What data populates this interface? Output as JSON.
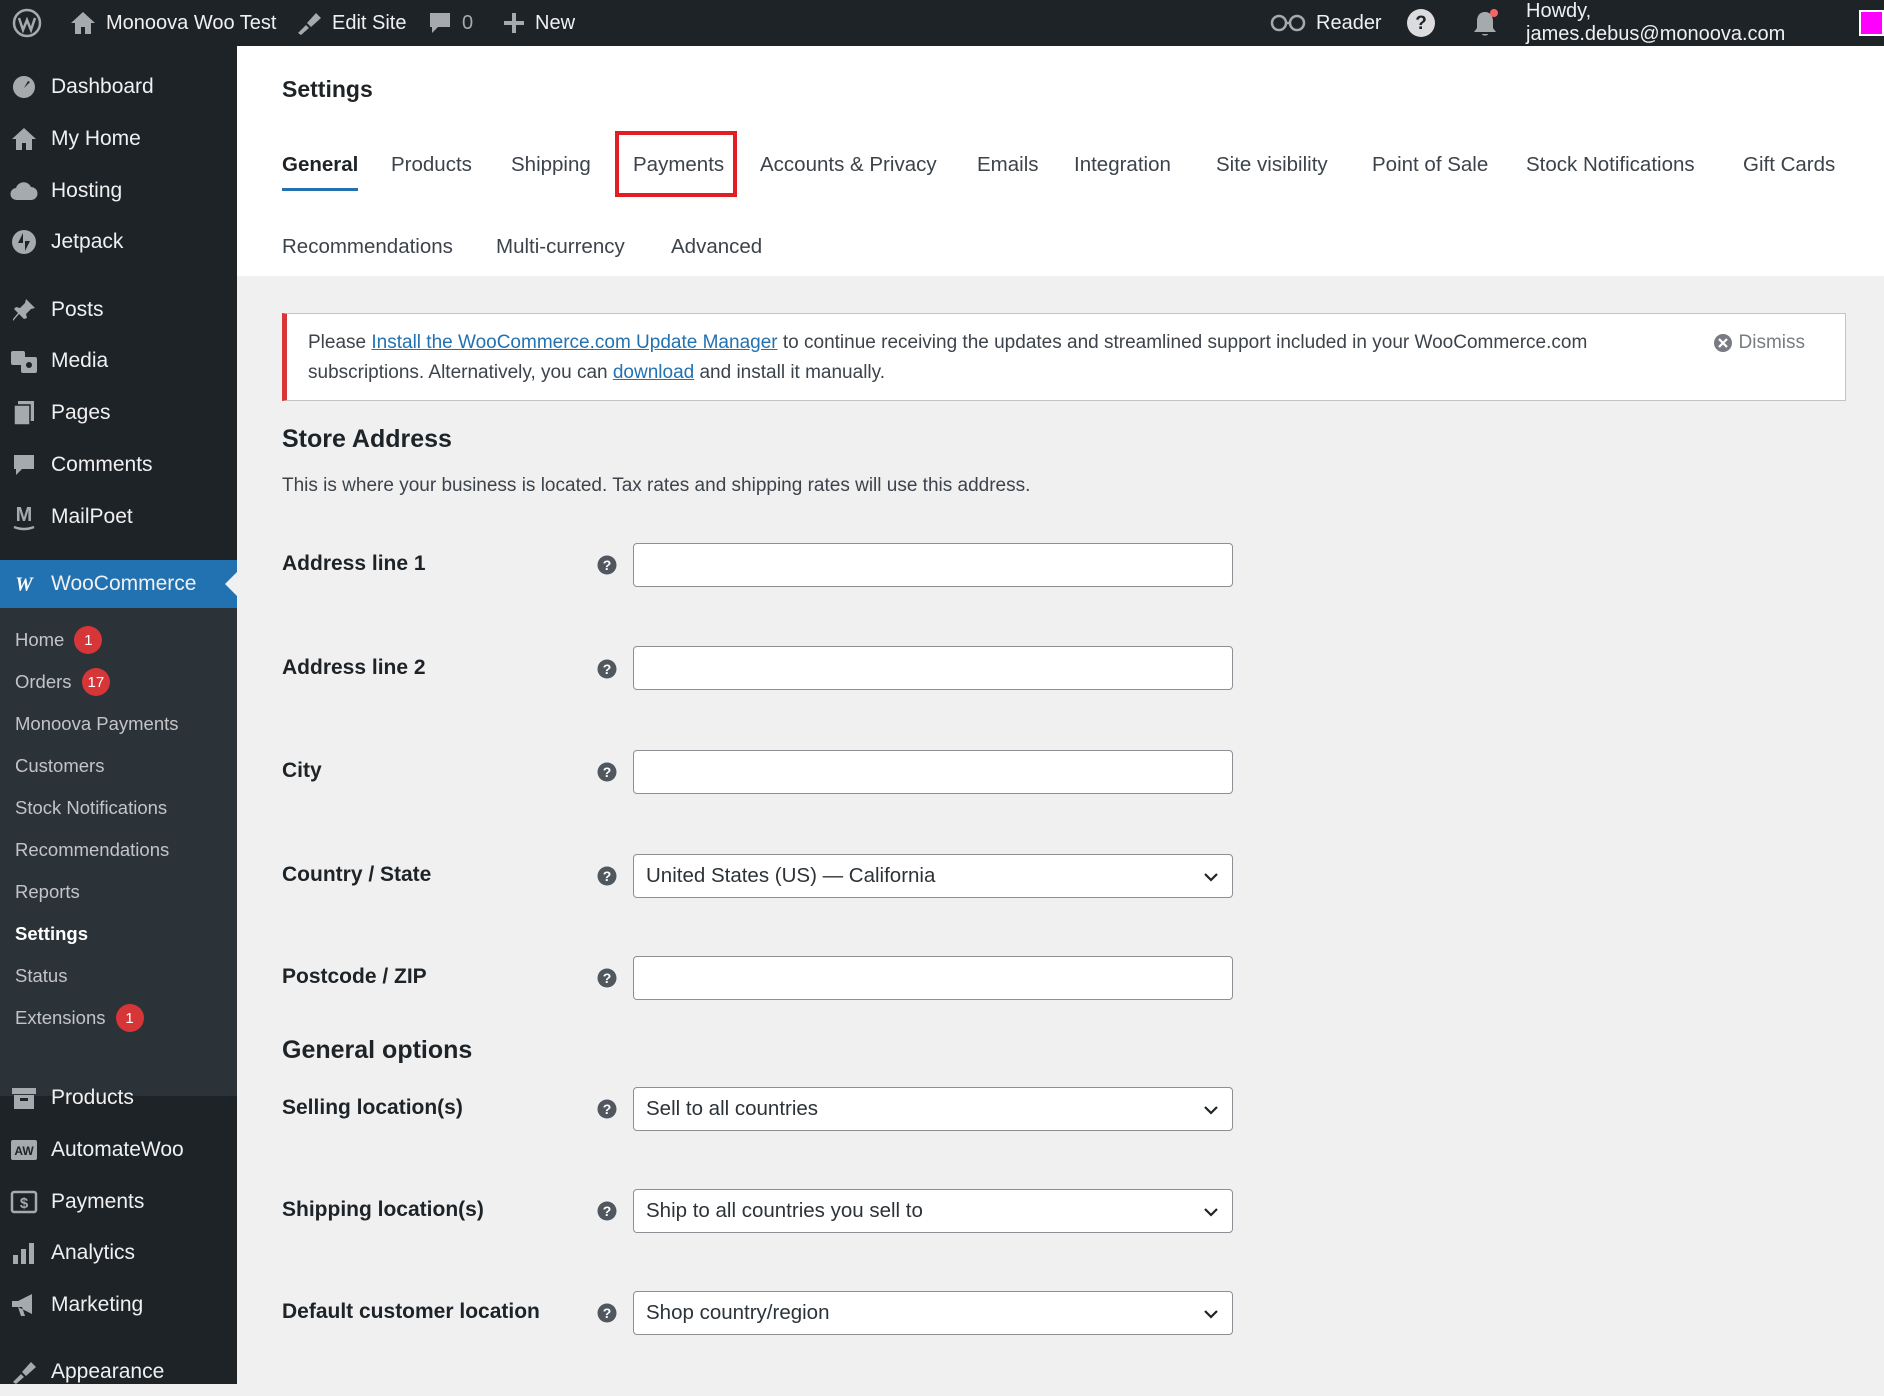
{
  "adminbar": {
    "site_name": "Monoova Woo Test",
    "edit_site": "Edit Site",
    "comments_count": "0",
    "new": "New",
    "reader": "Reader",
    "howdy": "Howdy, james.debus@monoova.com"
  },
  "sidebar": {
    "top": [
      "Dashboard",
      "My Home",
      "Hosting",
      "Jetpack"
    ],
    "content": [
      "Posts",
      "Media",
      "Pages",
      "Comments",
      "MailPoet"
    ],
    "woocommerce": "WooCommerce",
    "submenu": [
      {
        "label": "Home",
        "badge": "1"
      },
      {
        "label": "Orders",
        "badge": "17"
      },
      {
        "label": "Monoova Payments"
      },
      {
        "label": "Customers"
      },
      {
        "label": "Stock Notifications"
      },
      {
        "label": "Recommendations"
      },
      {
        "label": "Reports"
      },
      {
        "label": "Settings"
      },
      {
        "label": "Status"
      },
      {
        "label": "Extensions",
        "badge": "1"
      }
    ],
    "bottom": [
      "Products",
      "AutomateWoo",
      "Payments",
      "Analytics",
      "Marketing",
      "Appearance"
    ]
  },
  "page": {
    "title": "Settings",
    "tabs_row1": [
      "General",
      "Products",
      "Shipping",
      "Payments",
      "Accounts & Privacy",
      "Emails",
      "Integration",
      "Site visibility",
      "Point of Sale",
      "Stock Notifications",
      "Gift Cards"
    ],
    "tabs_row2": [
      "Recommendations",
      "Multi-currency",
      "Advanced"
    ]
  },
  "notice": {
    "text_before": "Please ",
    "link1": "Install the WooCommerce.com Update Manager",
    "text_middle": " to continue receiving the updates and streamlined support included in your WooCommerce.com subscriptions. Alternatively, you can ",
    "link2": "download",
    "text_after": " and install it manually.",
    "dismiss": "Dismiss"
  },
  "store_address": {
    "title": "Store Address",
    "description": "This is where your business is located. Tax rates and shipping rates will use this address.",
    "address1_label": "Address line 1",
    "address2_label": "Address line 2",
    "city_label": "City",
    "country_label": "Country / State",
    "country_value": "United States (US) — California",
    "postcode_label": "Postcode / ZIP"
  },
  "general_options": {
    "title": "General options",
    "selling_label": "Selling location(s)",
    "selling_value": "Sell to all countries",
    "shipping_label": "Shipping location(s)",
    "shipping_value": "Ship to all countries you sell to",
    "default_loc_label": "Default customer location",
    "default_loc_value": "Shop country/region"
  },
  "colors": {
    "admin_dark": "#1d2327",
    "submenu_bg": "#2c3338",
    "accent": "#2271b1",
    "badge": "#d63638",
    "highlight": "#e01e24"
  }
}
